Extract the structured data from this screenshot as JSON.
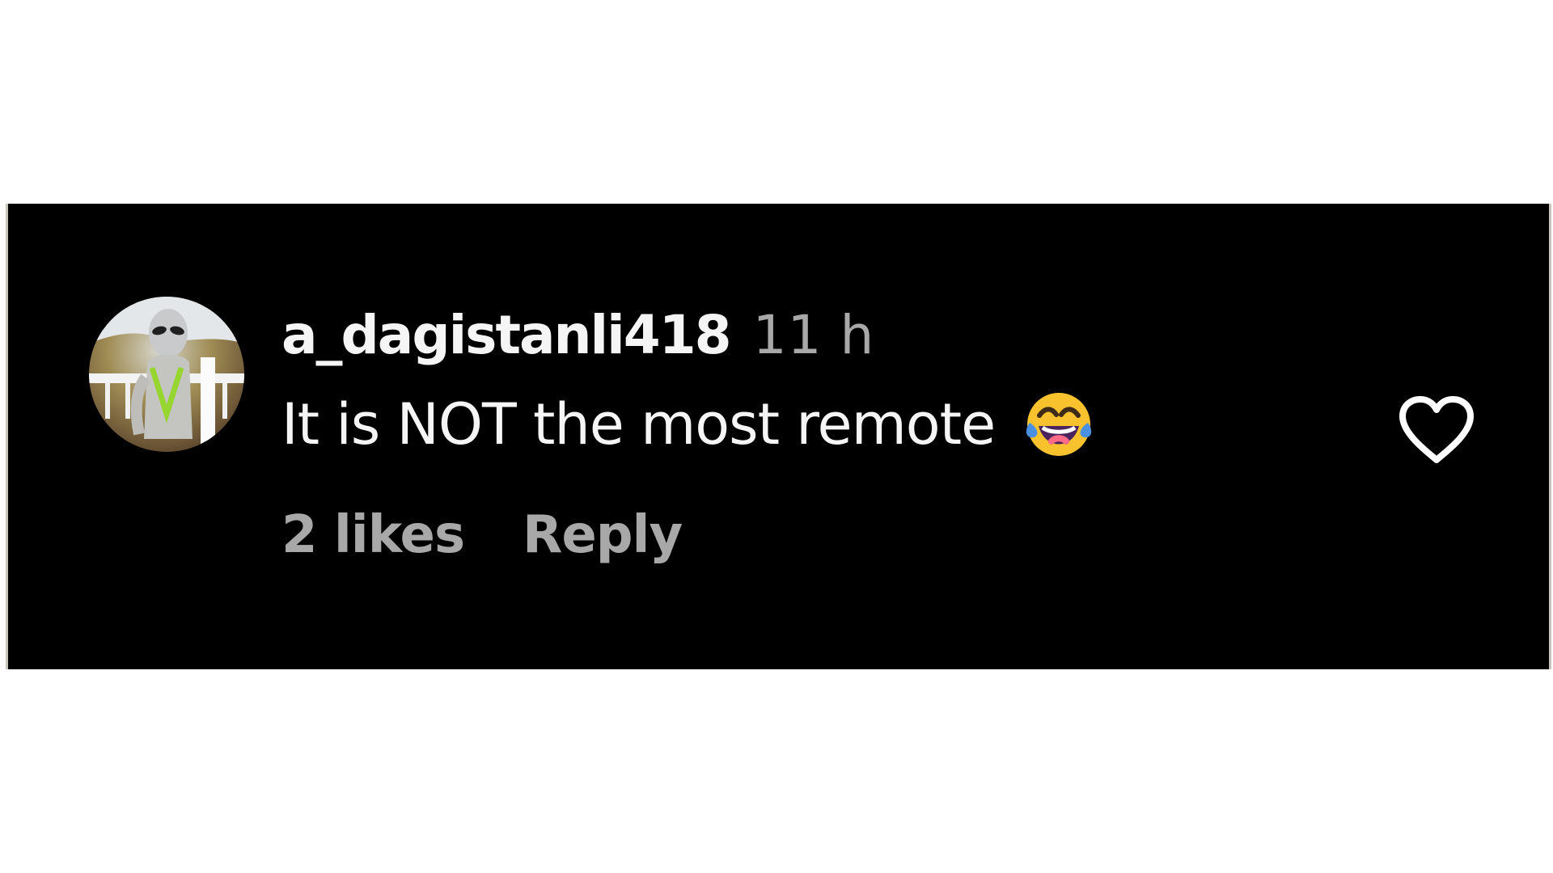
{
  "comment": {
    "username": "a_dagistanli418",
    "timestamp": "11 h",
    "text": "It is NOT the most remote",
    "emoji": "face-with-tears-of-joy-emoji",
    "likes_label": "2 likes",
    "reply_label": "Reply",
    "avatar_icon": "alien-avatar",
    "like_icon": "heart-outline-icon"
  },
  "colors": {
    "card_background": "#000000",
    "primary_text": "#f5f5f5",
    "secondary_text": "#a8a8a8",
    "emoji_face": "#f8c22e",
    "emoji_tears": "#4a90e2"
  }
}
